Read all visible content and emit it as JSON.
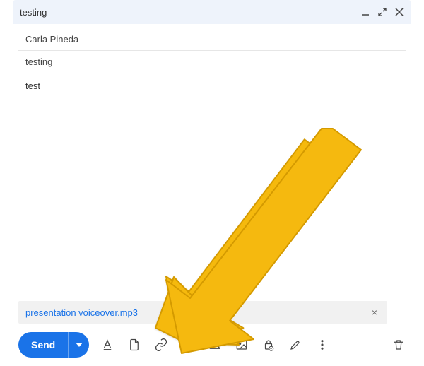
{
  "header": {
    "title": "testing"
  },
  "fields": {
    "to": "Carla Pineda",
    "subject": "testing"
  },
  "body": "test",
  "attachment": {
    "name": "presentation voiceover.mp3"
  },
  "toolbar": {
    "send_label": "Send"
  },
  "arrow": {
    "color": "#f5b90f",
    "stroke": "#d49a00"
  }
}
